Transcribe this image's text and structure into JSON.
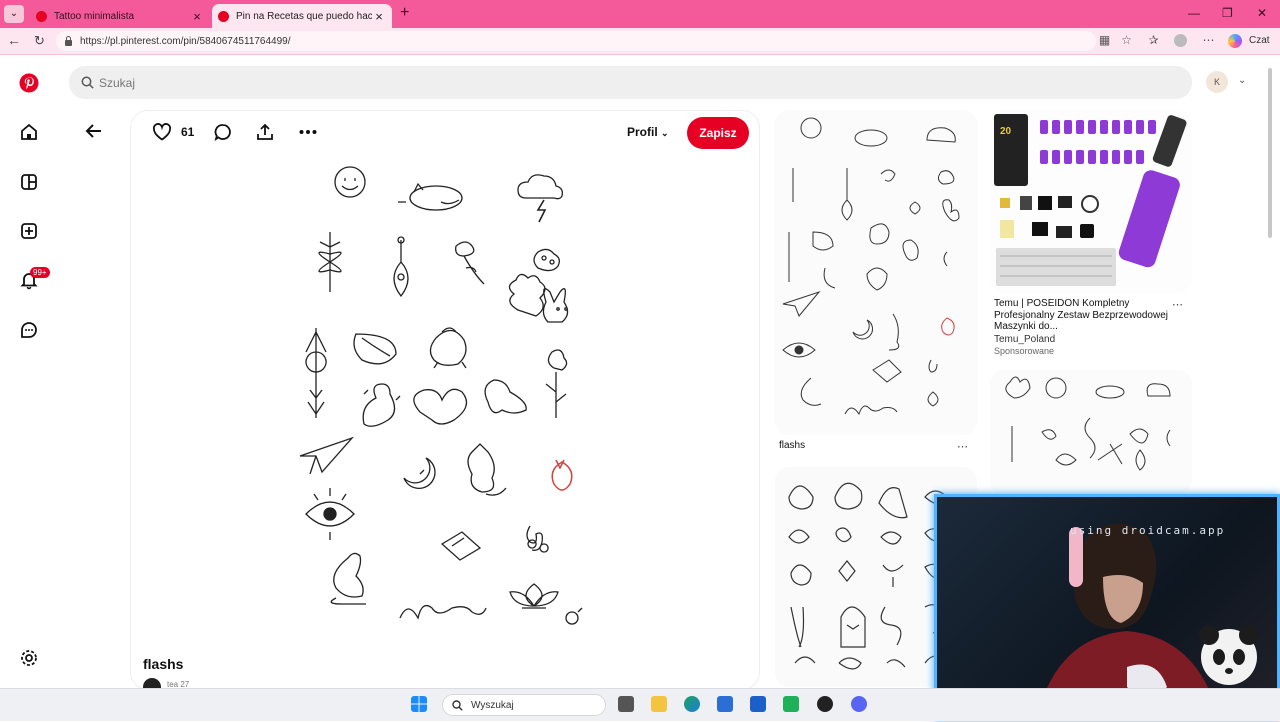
{
  "browser": {
    "tabs": [
      {
        "title": "Tattoo minimalista",
        "active": false
      },
      {
        "title": "Pin na Recetas que puedo hacer",
        "active": true
      }
    ],
    "url": "https://pl.pinterest.com/pin/584067451176449​9/",
    "copilot_label": "Czat"
  },
  "search": {
    "placeholder": "Szukaj"
  },
  "profile": {
    "initial": "K"
  },
  "sidebar": {
    "notifications_badge": "99+"
  },
  "pin": {
    "likes": "61",
    "profile_menu": "Profil",
    "save_label": "Zapisz",
    "title": "flashs",
    "user_line": "tea 27"
  },
  "grid": {
    "pin1_caption": "flashs",
    "ad_title": "Temu | POSEIDON Kompletny Profesjonalny Zestaw Bezprzewodowej Maszynki do...",
    "ad_source": "Temu_Poland",
    "ad_sponsored": "Sponsorowane"
  },
  "webcam": {
    "overlay_text": "using droidcam.app"
  },
  "taskbar": {
    "search_placeholder": "Wyszukaj"
  },
  "colors": {
    "brand": "#e60023",
    "tabstrip": "#f45a9a",
    "webcam_border": "#4fb4ff"
  },
  "icons": [
    "pinterest-logo",
    "home-icon",
    "explore-icon",
    "create-icon",
    "bell-icon",
    "chat-icon",
    "settings-icon",
    "heart-icon",
    "comment-icon",
    "share-icon",
    "more-icon",
    "back-arrow-icon",
    "search-icon"
  ]
}
